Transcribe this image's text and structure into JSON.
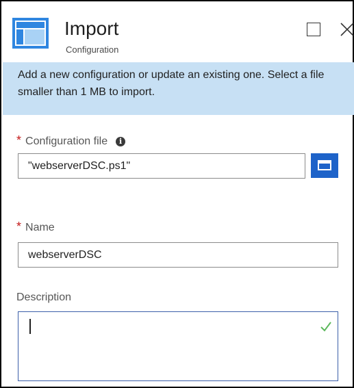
{
  "header": {
    "title": "Import",
    "subtitle": "Configuration"
  },
  "info_banner": {
    "text": "Add a new configuration or update an existing one. Select a file smaller than 1 MB to import."
  },
  "form": {
    "config_file": {
      "required_mark": "*",
      "label": "Configuration file",
      "info_icon_glyph": "i",
      "value": "\"webserverDSC.ps1\""
    },
    "name": {
      "required_mark": "*",
      "label": "Name",
      "value": "webserverDSC"
    },
    "description": {
      "label": "Description",
      "value": ""
    }
  },
  "icons": {
    "blade": "configuration-blade-icon",
    "maximize": "maximize-icon",
    "close": "close-icon",
    "info": "info-icon",
    "browse": "folder-icon",
    "valid": "checkmark-icon"
  },
  "colors": {
    "accent": "#1e63c9",
    "banner": "#c7e0f4",
    "required": "#c41b1b",
    "valid": "#5cb85c"
  }
}
